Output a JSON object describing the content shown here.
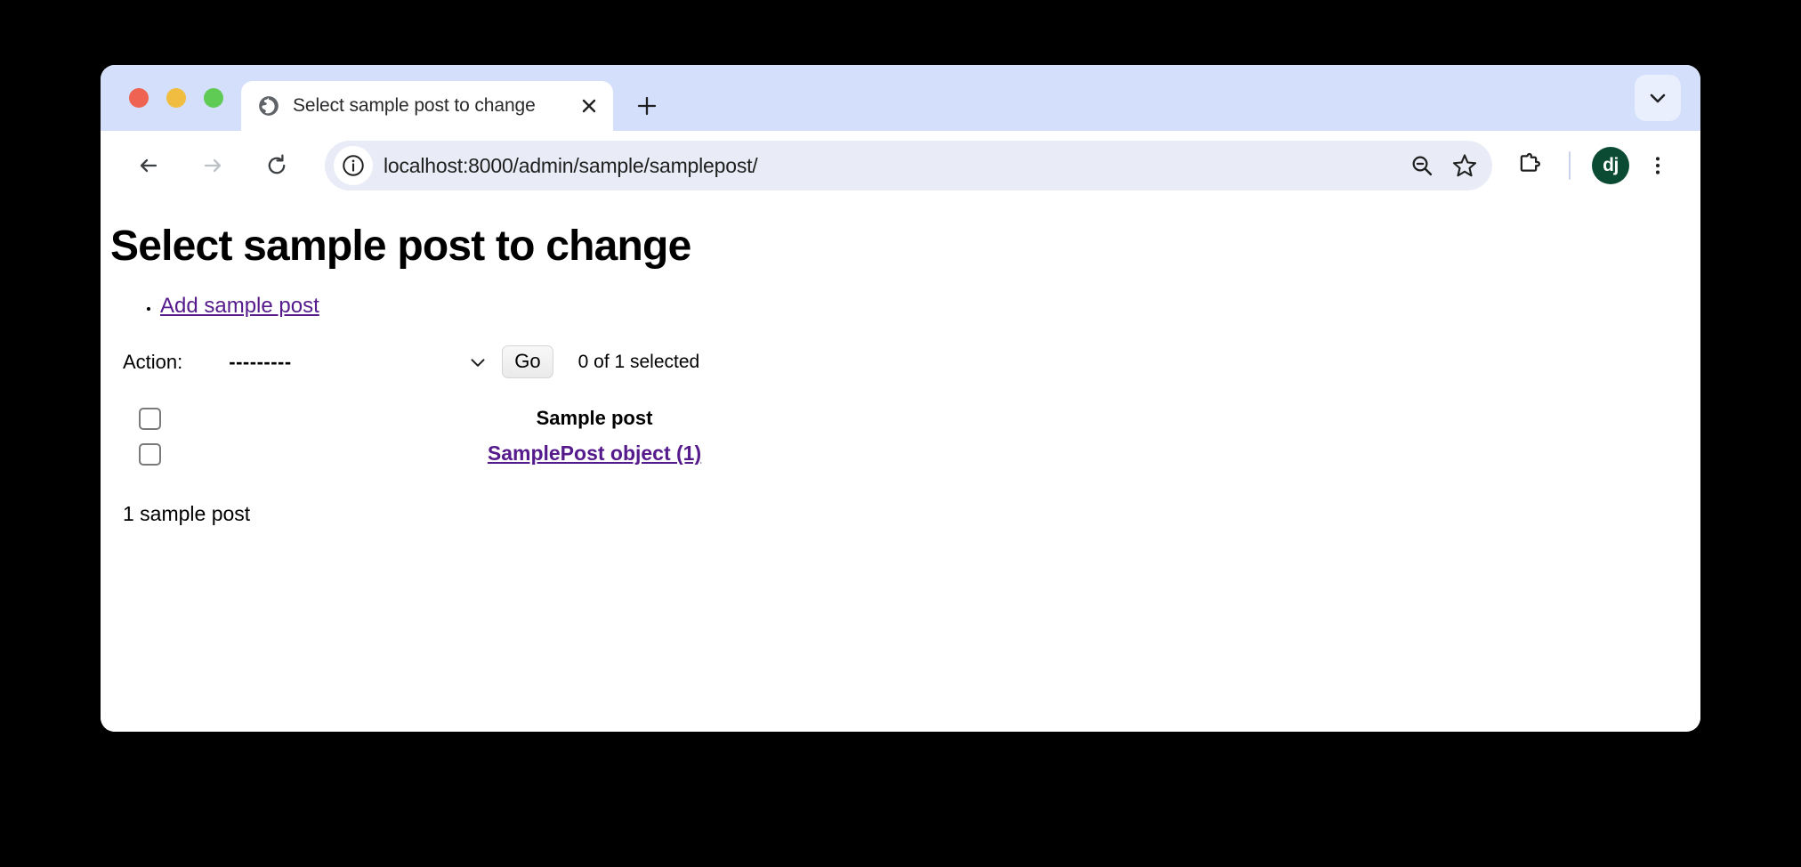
{
  "browser": {
    "traffic_lights": [
      "close",
      "minimize",
      "zoom"
    ],
    "tab": {
      "favicon": "globe-icon",
      "title": "Select sample post to change",
      "close_label": "×"
    },
    "new_tab_label": "+",
    "tab_search_label": "tab-search",
    "toolbar": {
      "back_label": "Back",
      "forward_label": "Forward",
      "reload_label": "Reload",
      "site_info_label": "View site information",
      "url": "localhost:8000/admin/sample/samplepost/",
      "zoom_out_label": "Zoom out",
      "bookmark_label": "Bookmark this tab",
      "extensions_label": "Extensions",
      "profile_initials": "dj",
      "menu_label": "Customize and control Google Chrome"
    }
  },
  "page": {
    "title": "Select sample post to change",
    "object_tools": [
      {
        "label": "Add sample post"
      }
    ],
    "actions": {
      "label": "Action:",
      "selected_option": "---------",
      "options": [
        "---------"
      ],
      "go_label": "Go",
      "counter": "0 of 1 selected"
    },
    "results": {
      "columns": [
        "",
        "Sample post"
      ],
      "rows": [
        {
          "checked": false,
          "name": "SamplePost object (1)"
        }
      ]
    },
    "paginator": "1 sample post"
  },
  "colors": {
    "tab_strip": "#d3dffb",
    "omnibox": "#e9ecf6",
    "link_visited": "#551a8b",
    "profile_badge": "#0c4b33",
    "page_background": "#ffffff",
    "desktop_background": "#000000"
  }
}
